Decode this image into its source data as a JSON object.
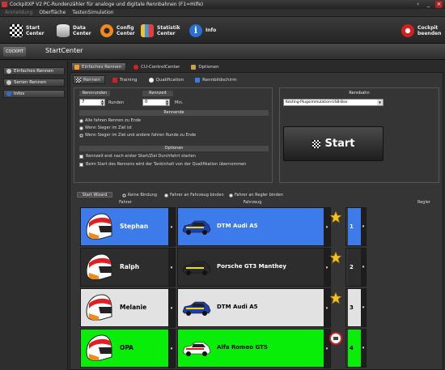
{
  "window": {
    "title": "CockpitXP V2 PC-Rundenzähler für analoge und digitale Rennbahnen (F1=Hilfe)",
    "buttons": [
      "‹",
      "_",
      "×"
    ]
  },
  "menu": [
    {
      "label": "Anmeldung",
      "disabled": true
    },
    {
      "label": "Oberfläche",
      "disabled": false
    },
    {
      "label": "TastenSimulation",
      "disabled": false
    }
  ],
  "toolbar": {
    "start": "Start Center",
    "data": "Data Center",
    "config": "Config Center",
    "statistik": "Statistik Center",
    "info": "Info",
    "exit": "Cockpit beenden"
  },
  "header": {
    "title": "StartCenter",
    "logo": "COCKPIT"
  },
  "sidebar": {
    "items": [
      "Einfaches Rennen",
      "Serien Rennen",
      "Infos"
    ]
  },
  "tabs": {
    "top": [
      "Einfaches Rennen",
      "CU-ControlCenter",
      "Optionen"
    ],
    "sub": [
      "Rennen",
      "Training",
      "Qualification",
      "Rennbildschirm"
    ]
  },
  "settings": {
    "rennrunden_label": "Rennrunden",
    "rennzeit_label": "Rennzeit",
    "runden_value": "7",
    "runden_unit": "Runden",
    "zeit_value": "0",
    "zeit_unit": "Min.",
    "rennende_label": "Rennende",
    "rennende_options": [
      "Alle fahren Rennen zu Ende",
      "Wenn Sieger im Ziel ist",
      "Wenn Sieger im Ziel und andere fahren Runde zu Ende"
    ],
    "rennende_selected": 2,
    "optionen_label": "Optionen",
    "checks": [
      "Rennzeit erst nach erster Start/Ziel Durchfahrt starten",
      "Beim Start des Rennens wird der Tankinhalt von der Qualifikation übernommen"
    ]
  },
  "track": {
    "label": "Rennbahn",
    "value": "Kosting-Plugsimmulation-USB-Box"
  },
  "start_button": "Start",
  "wizard": {
    "label": "Start Wizard",
    "options": [
      "Keine Bindung",
      "Fahrer an Fahrzeug binden",
      "Fahrer an Regler binden"
    ],
    "selected": 0
  },
  "grid_headers": {
    "fahrer": "Fahrer",
    "fahrzeug": "Fahrzeug",
    "regler": "Regler"
  },
  "drivers": [
    {
      "name": "Stephan",
      "car": "DTM Audi A5",
      "regler": "1",
      "bg": "#3d7bea",
      "fg": "#ffffff",
      "badge": "star-icon"
    },
    {
      "name": "Ralph",
      "car": "Porsche GT3 Manthey",
      "regler": "2",
      "bg": "#2d2d2d",
      "fg": "#ffffff",
      "badge": "star-icon"
    },
    {
      "name": "Melanie",
      "car": "DTM Audi A5",
      "regler": "3",
      "bg": "#e2e2e2",
      "fg": "#000000",
      "badge": "star-icon"
    },
    {
      "name": "OPA",
      "car": "Alfa Romeo GTS",
      "regler": "4",
      "bg": "#08ee08",
      "fg": "#000000",
      "badge": "speed-limit-icon"
    }
  ],
  "colors": {
    "accent": "#ff9a1a",
    "panel": "#353535"
  }
}
